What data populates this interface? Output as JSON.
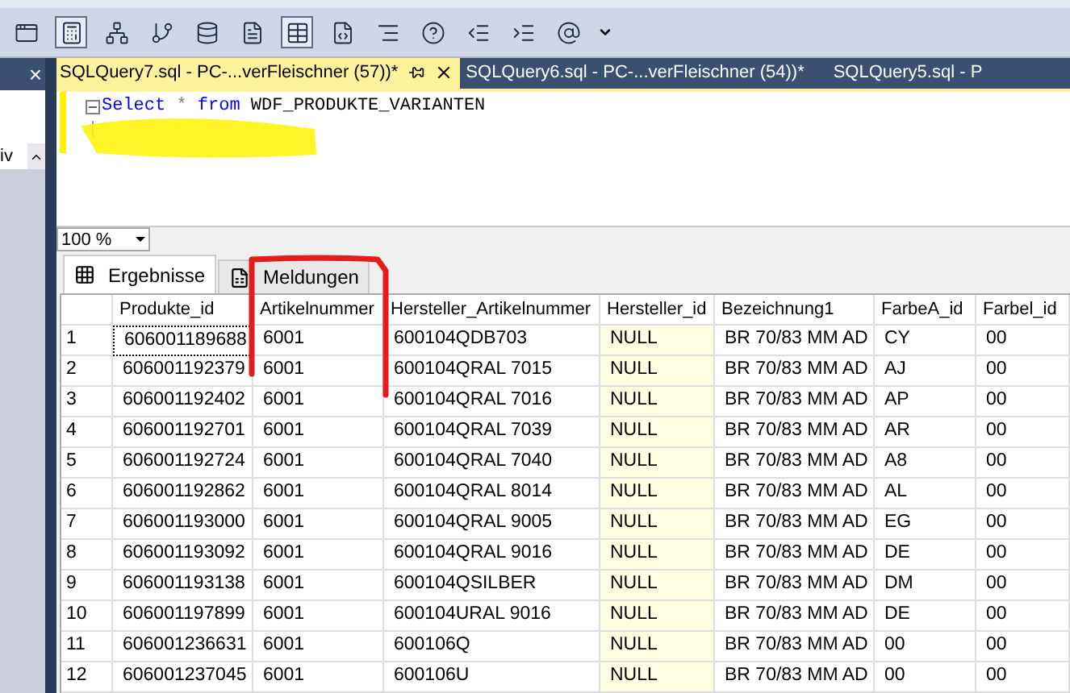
{
  "document_tabs": [
    {
      "label": "SQLQuery7.sql - PC-...verFleischner (57))*",
      "selected": true
    },
    {
      "label": "SQLQuery6.sql - PC-...verFleischner (54))*",
      "selected": false
    },
    {
      "label": "SQLQuery5.sql - P",
      "selected": false
    }
  ],
  "side_panel": {
    "close": "×",
    "label": "iv"
  },
  "editor": {
    "lines": [
      [
        {
          "text": "Select",
          "kind": "keyword"
        },
        {
          "text": " * ",
          "kind": "operator"
        },
        {
          "text": "from",
          "kind": "keyword"
        },
        {
          "text": " WDF_PRODUKTE_VARIANTEN",
          "kind": "plain"
        }
      ]
    ]
  },
  "zoom": "100 %",
  "result_tabs": [
    {
      "label": "Ergebnisse",
      "selected": true
    },
    {
      "label": "Meldungen",
      "selected": false
    }
  ],
  "grid": {
    "columns": [
      {
        "label": "Produkte_id",
        "highlighted": false
      },
      {
        "label": "Artikelnummer",
        "highlighted": false
      },
      {
        "label": "Hersteller_Artikelnummer",
        "highlighted": false
      },
      {
        "label": "Hersteller_id",
        "highlighted": true
      },
      {
        "label": "Bezeichnung1",
        "highlighted": false
      },
      {
        "label": "FarbeA_id",
        "highlighted": false
      },
      {
        "label": "Farbel_id",
        "highlighted": false
      }
    ],
    "rows": [
      {
        "number": "1",
        "focused": true,
        "cells": [
          "606001189688",
          "6001",
          "600104QDB703",
          "NULL",
          "BR 70/83 MM AD",
          "CY",
          "00"
        ]
      },
      {
        "number": "2",
        "focused": false,
        "cells": [
          "606001192379",
          "6001",
          "600104QRAL 7015",
          "NULL",
          "BR 70/83 MM AD",
          "AJ",
          "00"
        ]
      },
      {
        "number": "3",
        "focused": false,
        "cells": [
          "606001192402",
          "6001",
          "600104QRAL 7016",
          "NULL",
          "BR 70/83 MM AD",
          "AP",
          "00"
        ]
      },
      {
        "number": "4",
        "focused": false,
        "cells": [
          "606001192701",
          "6001",
          "600104QRAL 7039",
          "NULL",
          "BR 70/83 MM AD",
          "AR",
          "00"
        ]
      },
      {
        "number": "5",
        "focused": false,
        "cells": [
          "606001192724",
          "6001",
          "600104QRAL 7040",
          "NULL",
          "BR 70/83 MM AD",
          "A8",
          "00"
        ]
      },
      {
        "number": "6",
        "focused": false,
        "cells": [
          "606001192862",
          "6001",
          "600104QRAL 8014",
          "NULL",
          "BR 70/83 MM AD",
          "AL",
          "00"
        ]
      },
      {
        "number": "7",
        "focused": false,
        "cells": [
          "606001193000",
          "6001",
          "600104QRAL 9005",
          "NULL",
          "BR 70/83 MM AD",
          "EG",
          "00"
        ]
      },
      {
        "number": "8",
        "focused": false,
        "cells": [
          "606001193092",
          "6001",
          "600104QRAL 9016",
          "NULL",
          "BR 70/83 MM AD",
          "DE",
          "00"
        ]
      },
      {
        "number": "9",
        "focused": false,
        "cells": [
          "606001193138",
          "6001",
          "600104QSILBER",
          "NULL",
          "BR 70/83 MM AD",
          "DM",
          "00"
        ]
      },
      {
        "number": "10",
        "focused": false,
        "cells": [
          "606001197899",
          "6001",
          "600104URAL 9016",
          "NULL",
          "BR 70/83 MM AD",
          "DE",
          "00"
        ]
      },
      {
        "number": "11",
        "focused": false,
        "cells": [
          "606001236631",
          "6001",
          "600106Q",
          "NULL",
          "BR 70/83 MM AD",
          "00",
          "00"
        ]
      },
      {
        "number": "12",
        "focused": false,
        "cells": [
          "606001237045",
          "6001",
          "600106U",
          "NULL",
          "BR 70/83 MM AD",
          "00",
          "00"
        ]
      }
    ]
  }
}
